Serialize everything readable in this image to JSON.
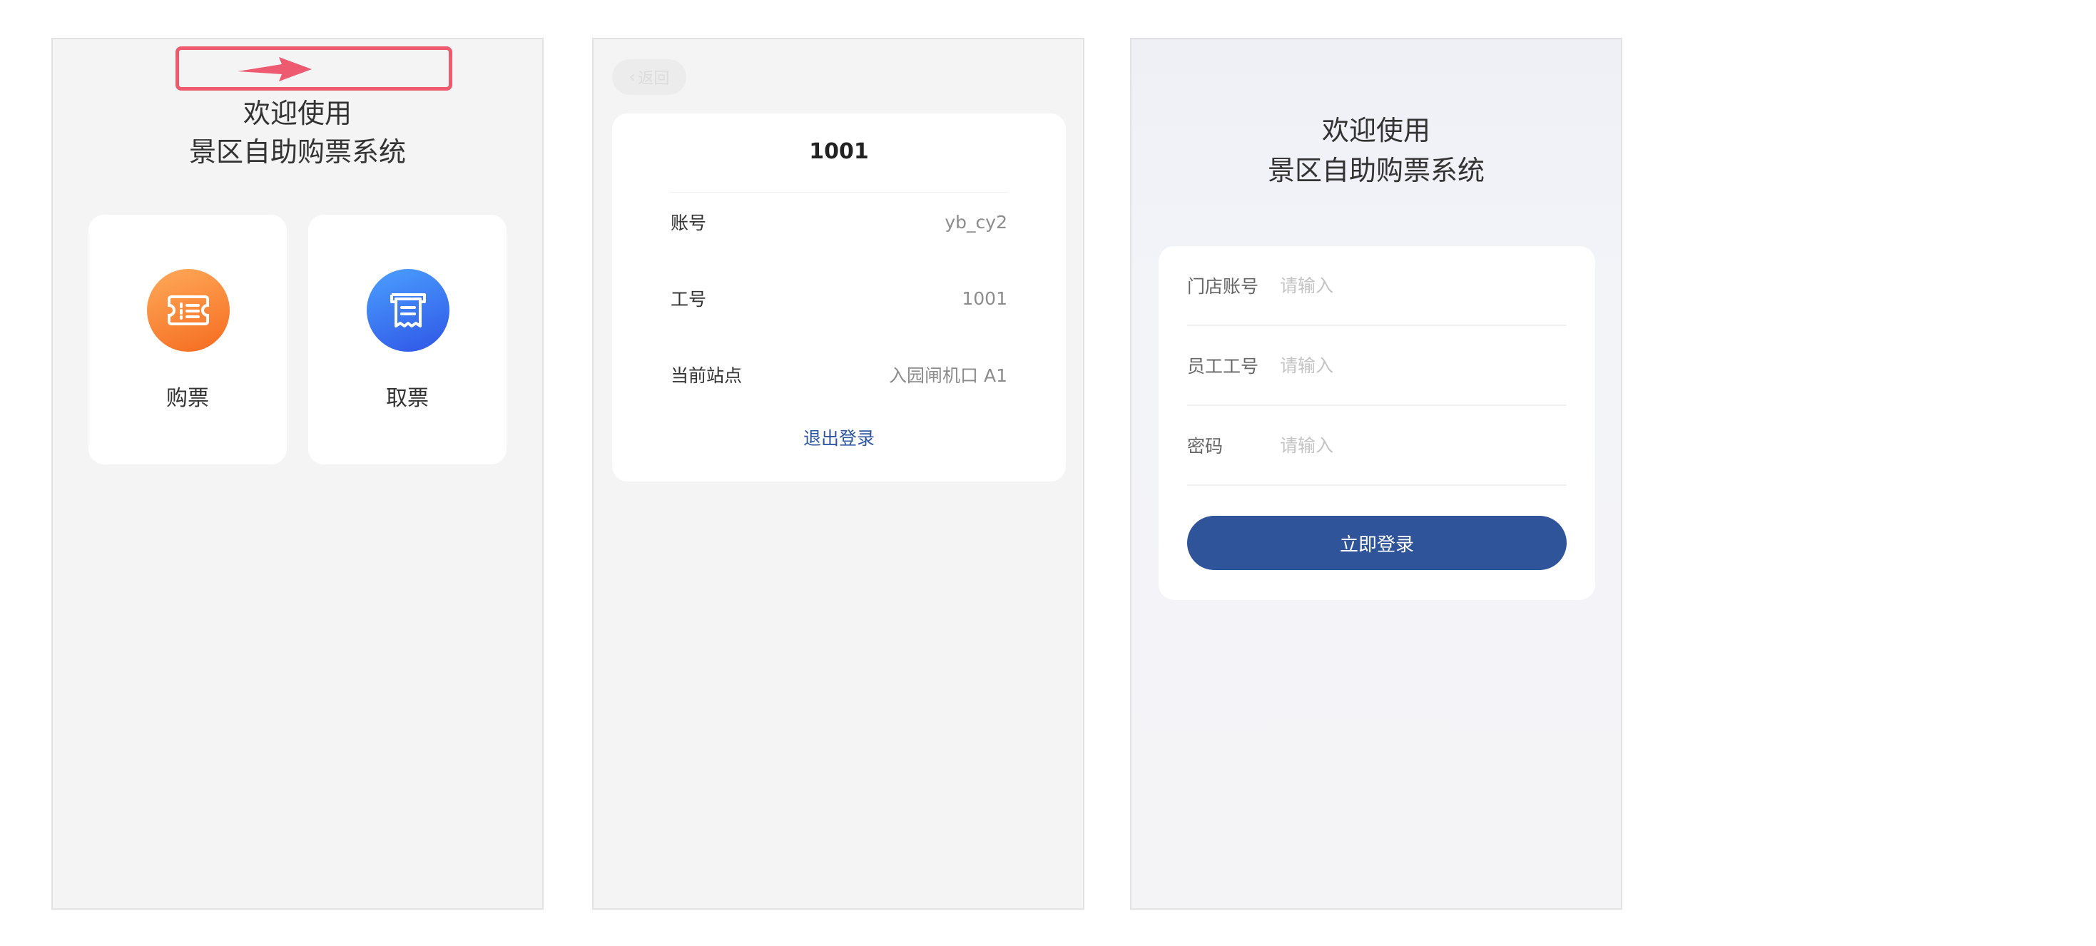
{
  "home": {
    "welcome_line1": "欢迎使用",
    "welcome_line2": "景区自助购票系统",
    "tiles": [
      {
        "label": "购票",
        "icon": "ticket-icon",
        "color": "#f97a2e"
      },
      {
        "label": "取票",
        "icon": "receipt-icon",
        "color": "#3a6ef0"
      }
    ],
    "highlight_color": "#ee5a6f"
  },
  "account": {
    "back_label": "返回",
    "id_title": "1001",
    "rows": [
      {
        "key": "账号",
        "value": "yb_cy2"
      },
      {
        "key": "工号",
        "value": "1001"
      },
      {
        "key": "当前站点",
        "value": "入园闸机口 A1"
      }
    ],
    "logout_label": "退出登录",
    "accent_color": "#2f56a3"
  },
  "login": {
    "welcome_line1": "欢迎使用",
    "welcome_line2": "景区自助购票系统",
    "fields": [
      {
        "label": "门店账号",
        "placeholder": "请输入"
      },
      {
        "label": "员工工号",
        "placeholder": "请输入"
      },
      {
        "label": "密码",
        "placeholder": "请输入"
      }
    ],
    "submit_label": "立即登录",
    "button_color": "#30549a"
  }
}
